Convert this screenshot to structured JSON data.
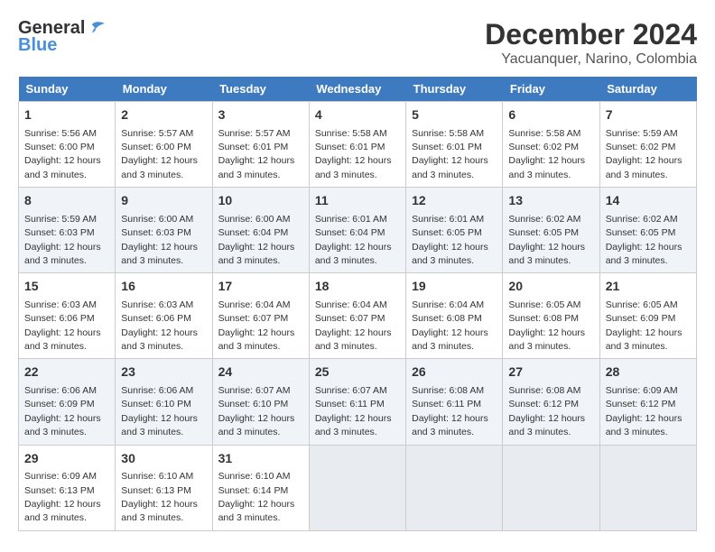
{
  "logo": {
    "line1": "General",
    "line2": "Blue"
  },
  "title": "December 2024",
  "subtitle": "Yacuanquer, Narino, Colombia",
  "days_of_week": [
    "Sunday",
    "Monday",
    "Tuesday",
    "Wednesday",
    "Thursday",
    "Friday",
    "Saturday"
  ],
  "weeks": [
    [
      {
        "day": "1",
        "sunrise": "5:56 AM",
        "sunset": "6:00 PM",
        "daylight": "12 hours and 3 minutes."
      },
      {
        "day": "2",
        "sunrise": "5:57 AM",
        "sunset": "6:00 PM",
        "daylight": "12 hours and 3 minutes."
      },
      {
        "day": "3",
        "sunrise": "5:57 AM",
        "sunset": "6:01 PM",
        "daylight": "12 hours and 3 minutes."
      },
      {
        "day": "4",
        "sunrise": "5:58 AM",
        "sunset": "6:01 PM",
        "daylight": "12 hours and 3 minutes."
      },
      {
        "day": "5",
        "sunrise": "5:58 AM",
        "sunset": "6:01 PM",
        "daylight": "12 hours and 3 minutes."
      },
      {
        "day": "6",
        "sunrise": "5:58 AM",
        "sunset": "6:02 PM",
        "daylight": "12 hours and 3 minutes."
      },
      {
        "day": "7",
        "sunrise": "5:59 AM",
        "sunset": "6:02 PM",
        "daylight": "12 hours and 3 minutes."
      }
    ],
    [
      {
        "day": "8",
        "sunrise": "5:59 AM",
        "sunset": "6:03 PM",
        "daylight": "12 hours and 3 minutes."
      },
      {
        "day": "9",
        "sunrise": "6:00 AM",
        "sunset": "6:03 PM",
        "daylight": "12 hours and 3 minutes."
      },
      {
        "day": "10",
        "sunrise": "6:00 AM",
        "sunset": "6:04 PM",
        "daylight": "12 hours and 3 minutes."
      },
      {
        "day": "11",
        "sunrise": "6:01 AM",
        "sunset": "6:04 PM",
        "daylight": "12 hours and 3 minutes."
      },
      {
        "day": "12",
        "sunrise": "6:01 AM",
        "sunset": "6:05 PM",
        "daylight": "12 hours and 3 minutes."
      },
      {
        "day": "13",
        "sunrise": "6:02 AM",
        "sunset": "6:05 PM",
        "daylight": "12 hours and 3 minutes."
      },
      {
        "day": "14",
        "sunrise": "6:02 AM",
        "sunset": "6:05 PM",
        "daylight": "12 hours and 3 minutes."
      }
    ],
    [
      {
        "day": "15",
        "sunrise": "6:03 AM",
        "sunset": "6:06 PM",
        "daylight": "12 hours and 3 minutes."
      },
      {
        "day": "16",
        "sunrise": "6:03 AM",
        "sunset": "6:06 PM",
        "daylight": "12 hours and 3 minutes."
      },
      {
        "day": "17",
        "sunrise": "6:04 AM",
        "sunset": "6:07 PM",
        "daylight": "12 hours and 3 minutes."
      },
      {
        "day": "18",
        "sunrise": "6:04 AM",
        "sunset": "6:07 PM",
        "daylight": "12 hours and 3 minutes."
      },
      {
        "day": "19",
        "sunrise": "6:04 AM",
        "sunset": "6:08 PM",
        "daylight": "12 hours and 3 minutes."
      },
      {
        "day": "20",
        "sunrise": "6:05 AM",
        "sunset": "6:08 PM",
        "daylight": "12 hours and 3 minutes."
      },
      {
        "day": "21",
        "sunrise": "6:05 AM",
        "sunset": "6:09 PM",
        "daylight": "12 hours and 3 minutes."
      }
    ],
    [
      {
        "day": "22",
        "sunrise": "6:06 AM",
        "sunset": "6:09 PM",
        "daylight": "12 hours and 3 minutes."
      },
      {
        "day": "23",
        "sunrise": "6:06 AM",
        "sunset": "6:10 PM",
        "daylight": "12 hours and 3 minutes."
      },
      {
        "day": "24",
        "sunrise": "6:07 AM",
        "sunset": "6:10 PM",
        "daylight": "12 hours and 3 minutes."
      },
      {
        "day": "25",
        "sunrise": "6:07 AM",
        "sunset": "6:11 PM",
        "daylight": "12 hours and 3 minutes."
      },
      {
        "day": "26",
        "sunrise": "6:08 AM",
        "sunset": "6:11 PM",
        "daylight": "12 hours and 3 minutes."
      },
      {
        "day": "27",
        "sunrise": "6:08 AM",
        "sunset": "6:12 PM",
        "daylight": "12 hours and 3 minutes."
      },
      {
        "day": "28",
        "sunrise": "6:09 AM",
        "sunset": "6:12 PM",
        "daylight": "12 hours and 3 minutes."
      }
    ],
    [
      {
        "day": "29",
        "sunrise": "6:09 AM",
        "sunset": "6:13 PM",
        "daylight": "12 hours and 3 minutes."
      },
      {
        "day": "30",
        "sunrise": "6:10 AM",
        "sunset": "6:13 PM",
        "daylight": "12 hours and 3 minutes."
      },
      {
        "day": "31",
        "sunrise": "6:10 AM",
        "sunset": "6:14 PM",
        "daylight": "12 hours and 3 minutes."
      },
      null,
      null,
      null,
      null
    ]
  ],
  "labels": {
    "sunrise": "Sunrise:",
    "sunset": "Sunset:",
    "daylight": "Daylight: 12 hours"
  }
}
